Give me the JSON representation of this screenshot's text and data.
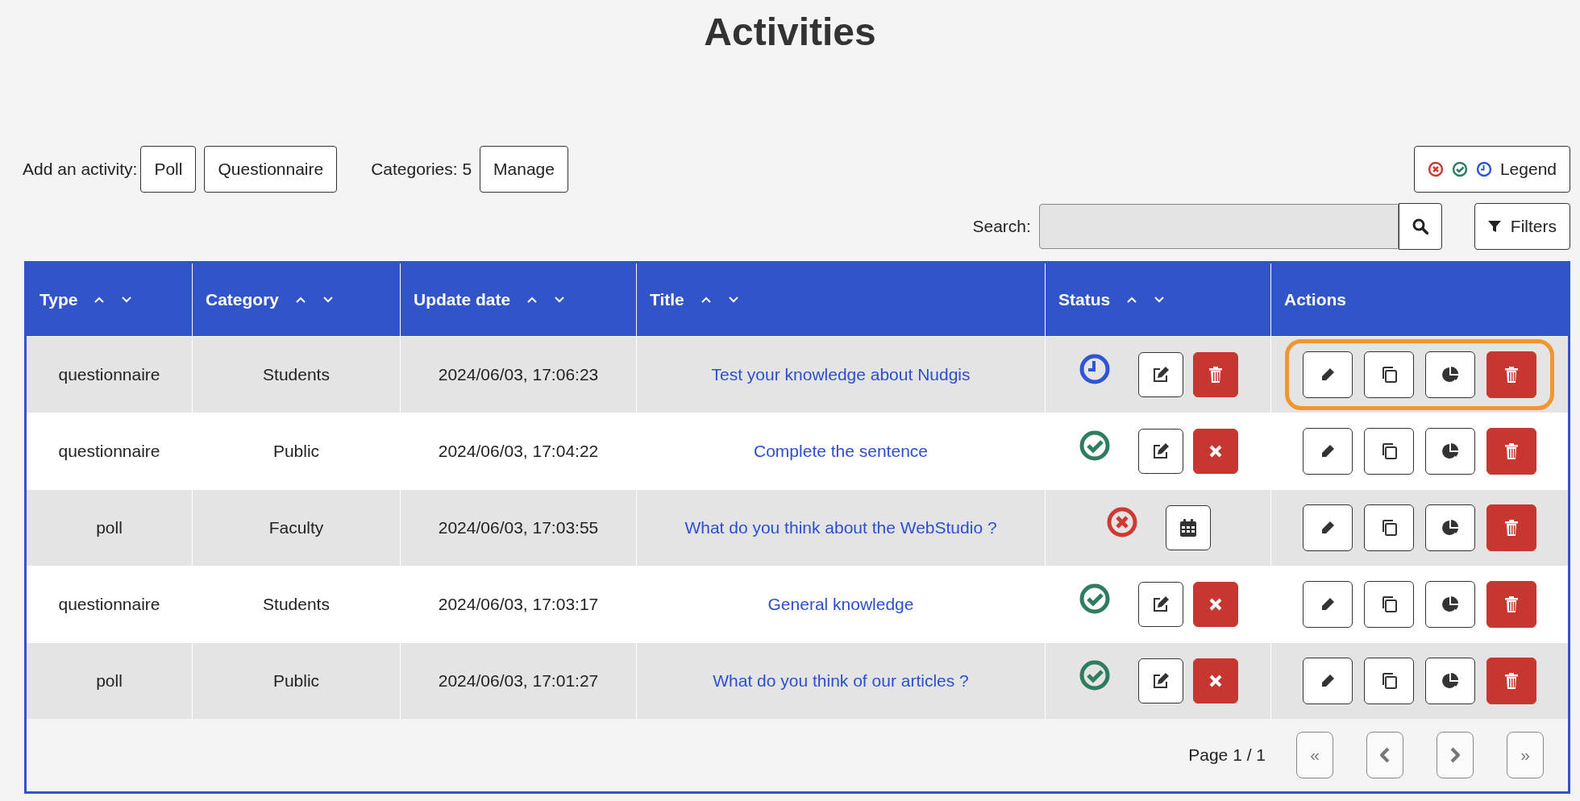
{
  "page_title": "Activities",
  "add_activity": {
    "label": "Add an activity:",
    "buttons": [
      "Poll",
      "Questionnaire"
    ]
  },
  "categories": {
    "label": "Categories: 5",
    "button": "Manage"
  },
  "legend": {
    "label": "Legend"
  },
  "search": {
    "label": "Search:"
  },
  "filters": {
    "label": "Filters"
  },
  "table": {
    "columns": [
      {
        "label": "Type",
        "sortable": true
      },
      {
        "label": "Category",
        "sortable": true
      },
      {
        "label": "Update date",
        "sortable": true
      },
      {
        "label": "Title",
        "sortable": true
      },
      {
        "label": "Status",
        "sortable": true
      },
      {
        "label": "Actions",
        "sortable": false
      }
    ],
    "rows": [
      {
        "type": "questionnaire",
        "category": "Students",
        "date": "2024/06/03, 17:06:23",
        "title": "Test your knowledge about Nudgis",
        "status": {
          "kind": "scheduled"
        },
        "status_buttons": [
          {
            "kind": "edit"
          },
          {
            "kind": "delete"
          }
        ],
        "highlighted": true
      },
      {
        "type": "questionnaire",
        "category": "Public",
        "date": "2024/06/03, 17:04:22",
        "title": "Complete the sentence",
        "status": {
          "kind": "published"
        },
        "status_buttons": [
          {
            "kind": "edit"
          },
          {
            "kind": "unpublish"
          }
        ],
        "highlighted": false
      },
      {
        "type": "poll",
        "category": "Faculty",
        "date": "2024/06/03, 17:03:55",
        "title": "What do you think about the WebStudio ?",
        "status": {
          "kind": "closed"
        },
        "status_buttons": [
          {
            "kind": "schedule"
          }
        ],
        "highlighted": false
      },
      {
        "type": "questionnaire",
        "category": "Students",
        "date": "2024/06/03, 17:03:17",
        "title": "General knowledge",
        "status": {
          "kind": "published"
        },
        "status_buttons": [
          {
            "kind": "edit"
          },
          {
            "kind": "unpublish"
          }
        ],
        "highlighted": false
      },
      {
        "type": "poll",
        "category": "Public",
        "date": "2024/06/03, 17:01:27",
        "title": "What do you think of our articles ?",
        "status": {
          "kind": "published"
        },
        "status_buttons": [
          {
            "kind": "edit"
          },
          {
            "kind": "unpublish"
          }
        ],
        "highlighted": false
      }
    ]
  },
  "pagination": {
    "label": "Page 1 / 1",
    "first": "«",
    "last": "»"
  }
}
